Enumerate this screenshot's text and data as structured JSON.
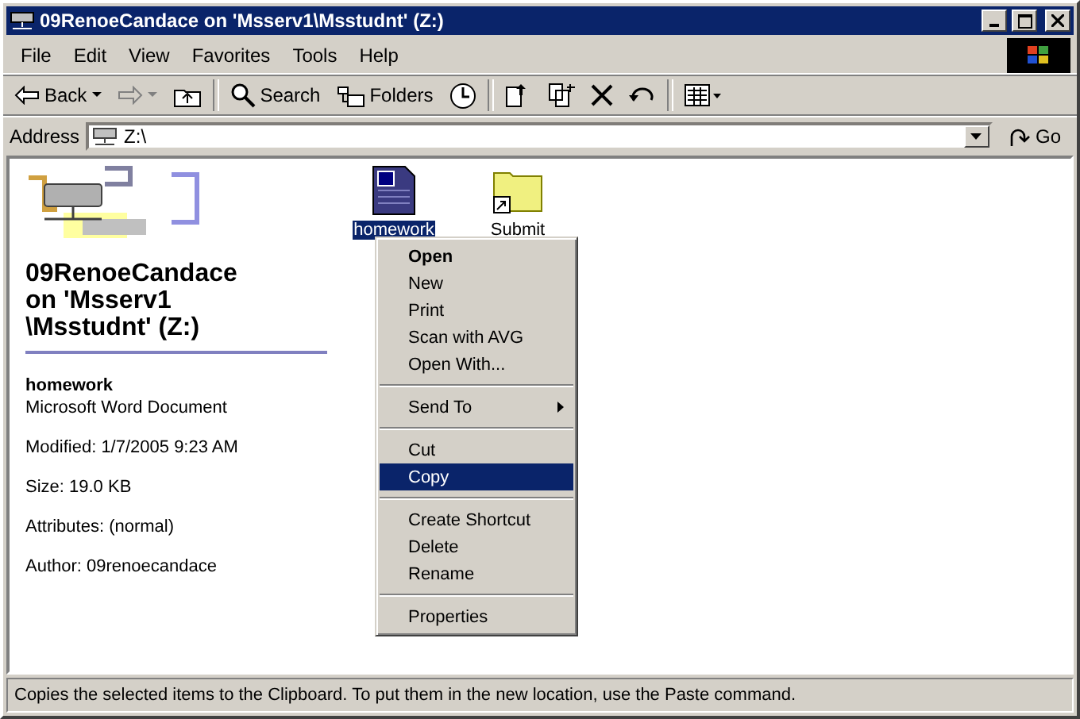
{
  "window": {
    "title": "09RenoeCandace on 'Msserv1\\Msstudnt' (Z:)"
  },
  "menu_bar": [
    {
      "label": "File"
    },
    {
      "label": "Edit"
    },
    {
      "label": "View"
    },
    {
      "label": "Favorites"
    },
    {
      "label": "Tools"
    },
    {
      "label": "Help"
    }
  ],
  "toolbar": [
    {
      "kind": "back",
      "label": "Back",
      "disabled": false
    },
    {
      "kind": "forward",
      "disabled": true
    },
    {
      "kind": "up",
      "disabled": false
    },
    {
      "kind": "search",
      "label": "Search",
      "disabled": false
    },
    {
      "kind": "folders",
      "label": "Folders",
      "disabled": false
    },
    {
      "kind": "history",
      "disabled": false
    },
    {
      "kind": "move",
      "disabled": false
    },
    {
      "kind": "copy",
      "disabled": false
    },
    {
      "kind": "delete",
      "disabled": false
    },
    {
      "kind": "undo",
      "disabled": false
    },
    {
      "kind": "views",
      "disabled": false
    }
  ],
  "address": {
    "label": "Address",
    "value": "Z:\\",
    "go": "Go"
  },
  "info_panel": {
    "heading": "09RenoeCandace on 'Msserv1 \\Msstudnt' (Z:)",
    "file_name": "homework",
    "file_type": "Microsoft Word Document",
    "details": [
      "Modified: 1/7/2005 9:23 AM",
      "Size: 19.0 KB",
      "Attributes: (normal)",
      "Author: 09renoecandace"
    ]
  },
  "files": [
    {
      "label": "homework",
      "kind": "document",
      "selected": true
    },
    {
      "label": "Submit",
      "kind": "folder-shortcut",
      "selected": false
    }
  ],
  "context_menu": [
    {
      "kind": "item",
      "label": "Open",
      "default": true,
      "selected": false
    },
    {
      "kind": "item",
      "label": "New",
      "default": false,
      "selected": false
    },
    {
      "kind": "item",
      "label": "Print",
      "default": false,
      "selected": false
    },
    {
      "kind": "item",
      "label": "Scan with AVG",
      "default": false,
      "selected": false
    },
    {
      "kind": "item",
      "label": "Open With...",
      "default": false,
      "selected": false
    },
    {
      "kind": "separator"
    },
    {
      "kind": "submenu",
      "label": "Send To",
      "default": false,
      "selected": false
    },
    {
      "kind": "separator"
    },
    {
      "kind": "item",
      "label": "Cut",
      "default": false,
      "selected": false
    },
    {
      "kind": "item",
      "label": "Copy",
      "default": false,
      "selected": true
    },
    {
      "kind": "separator"
    },
    {
      "kind": "item",
      "label": "Create Shortcut",
      "default": false,
      "selected": false
    },
    {
      "kind": "item",
      "label": "Delete",
      "default": false,
      "selected": false
    },
    {
      "kind": "item",
      "label": "Rename",
      "default": false,
      "selected": false
    },
    {
      "kind": "separator"
    },
    {
      "kind": "item",
      "label": "Properties",
      "default": false,
      "selected": false
    }
  ],
  "status_bar": {
    "text": "Copies the selected items to the Clipboard. To put them in the new location, use the Paste command."
  }
}
